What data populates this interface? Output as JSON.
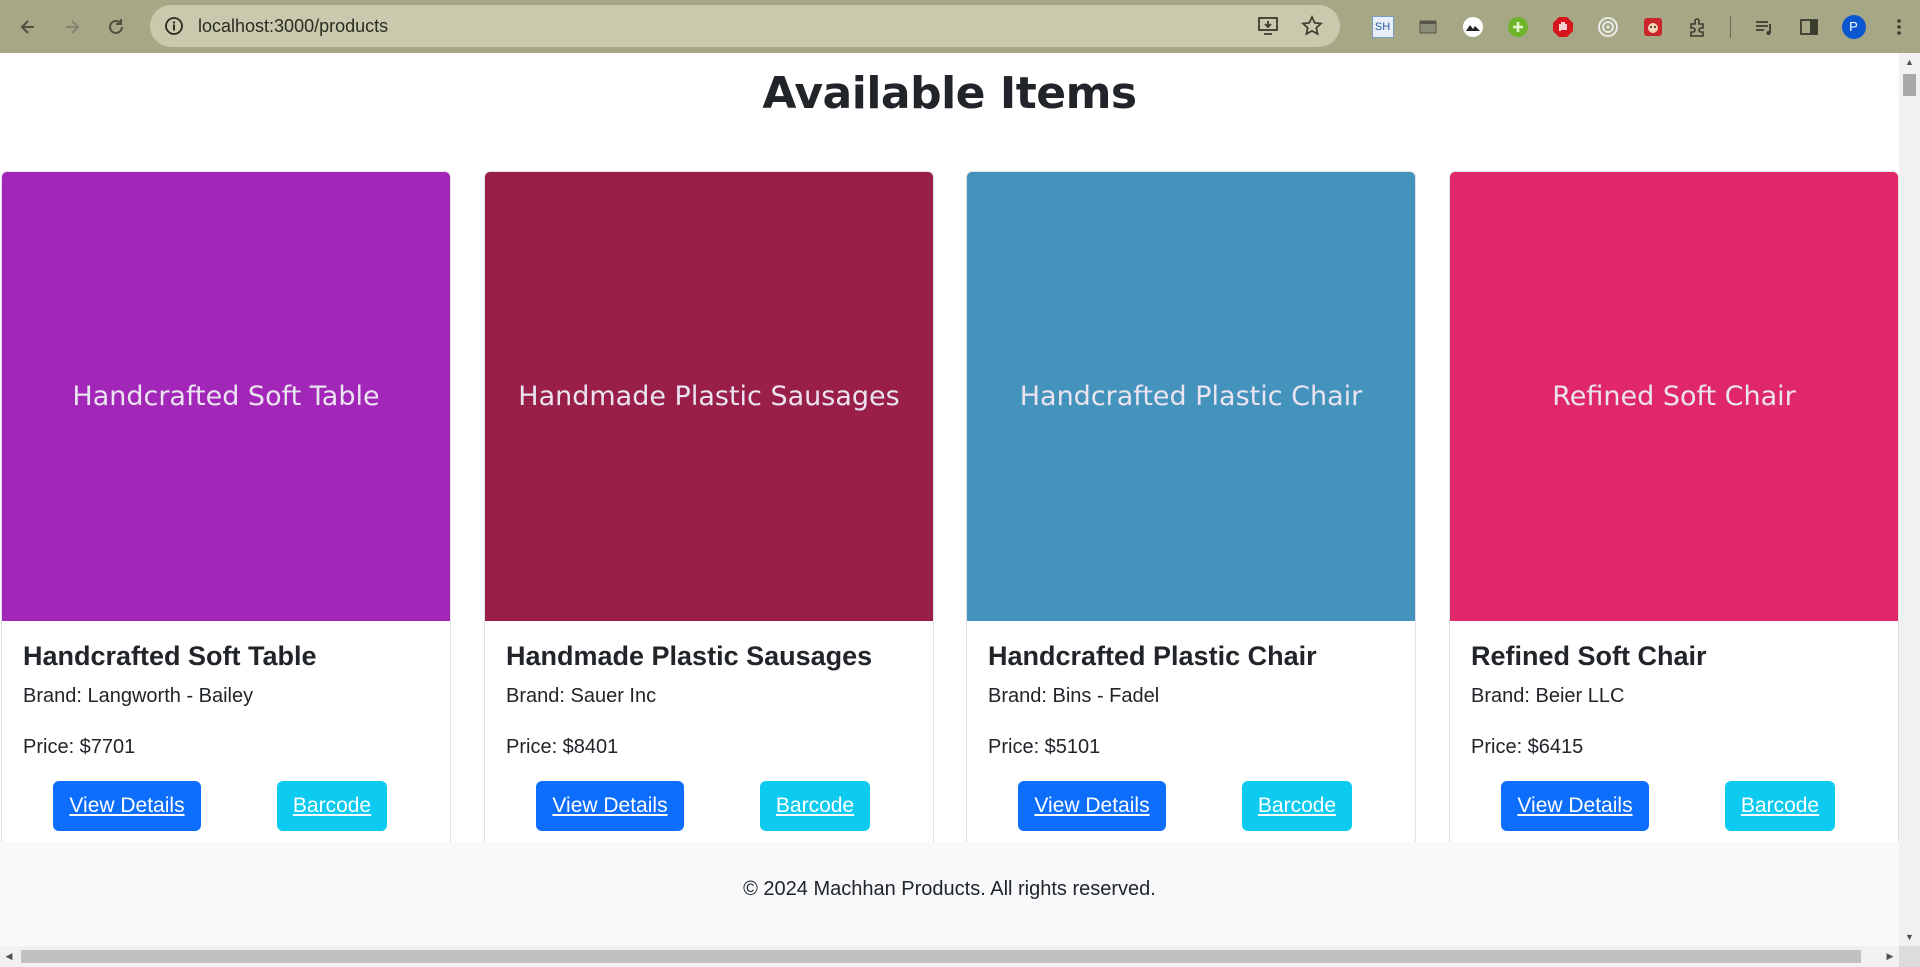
{
  "browser": {
    "url": "localhost:3000/products",
    "profile_initial": "P",
    "extensions": [
      {
        "icon": "sh-extension-icon",
        "label": "SH"
      },
      {
        "icon": "tab-manager-icon",
        "label": ""
      },
      {
        "icon": "mountain-extension-icon",
        "label": ""
      },
      {
        "icon": "green-plus-extension-icon",
        "label": ""
      },
      {
        "icon": "adblock-hand-icon",
        "label": ""
      },
      {
        "icon": "target-extension-icon",
        "label": ""
      },
      {
        "icon": "red-bug-extension-icon",
        "label": ""
      },
      {
        "icon": "puzzle-extensions-icon",
        "label": ""
      }
    ]
  },
  "page": {
    "title": "Available Items"
  },
  "products": [
    {
      "image_text": "Handcrafted Soft Table",
      "color": "#a227b8",
      "title": "Handcrafted Soft Table",
      "brand": "Brand: Langworth - Bailey",
      "price": "Price: $7701",
      "details_label": "View Details",
      "barcode_label": "Barcode"
    },
    {
      "image_text": "Handmade Plastic Sausages",
      "color": "#991f48",
      "title": "Handmade Plastic Sausages",
      "brand": "Brand: Sauer Inc",
      "price": "Price: $8401",
      "details_label": "View Details",
      "barcode_label": "Barcode"
    },
    {
      "image_text": "Handcrafted Plastic Chair",
      "color": "#4493bd",
      "title": "Handcrafted Plastic Chair",
      "brand": "Brand: Bins - Fadel",
      "price": "Price: $5101",
      "details_label": "View Details",
      "barcode_label": "Barcode"
    },
    {
      "image_text": "Refined Soft Chair",
      "color": "#e0276a",
      "title": "Refined Soft Chair",
      "brand": "Brand: Beier LLC",
      "price": "Price: $6415",
      "details_label": "View Details",
      "barcode_label": "Barcode"
    }
  ],
  "footer": {
    "text": "© 2024 Machhan Products. All rights reserved."
  },
  "colors": {
    "primary_button": "#0d6efd",
    "info_button": "#0dcaf0",
    "chrome_bar": "#a6a785"
  }
}
